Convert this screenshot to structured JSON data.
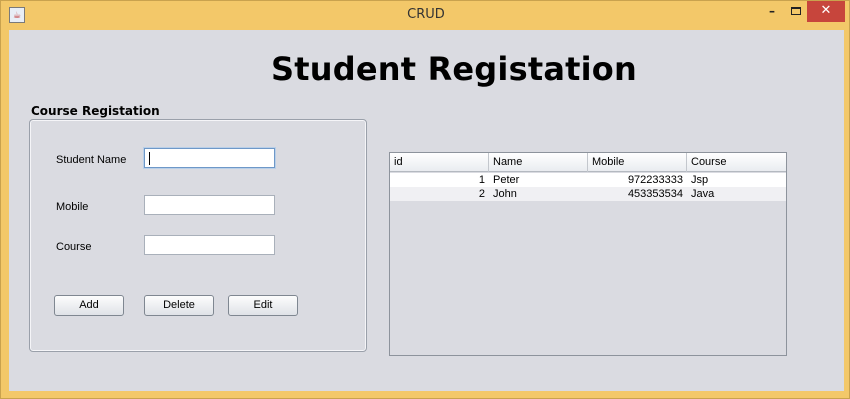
{
  "window": {
    "title": "CRUD",
    "icon": "java-cup-icon",
    "minimize": "–",
    "close": "✕"
  },
  "page": {
    "heading": "Student Registation"
  },
  "form": {
    "group_title": "Course Registation",
    "fields": {
      "student_name": {
        "label": "Student Name",
        "value": ""
      },
      "mobile": {
        "label": "Mobile",
        "value": ""
      },
      "course": {
        "label": "Course",
        "value": ""
      }
    },
    "buttons": {
      "add": "Add",
      "delete": "Delete",
      "edit": "Edit"
    }
  },
  "table": {
    "columns": [
      "id",
      "Name",
      "Mobile",
      "Course"
    ],
    "rows": [
      [
        "1",
        "Peter",
        "972233333",
        "Jsp"
      ],
      [
        "2",
        "John",
        "453353534",
        "Java"
      ]
    ]
  },
  "colors": {
    "window_frame": "#f3c869",
    "client_bg": "#dadbe1",
    "close_button": "#c7453c"
  }
}
